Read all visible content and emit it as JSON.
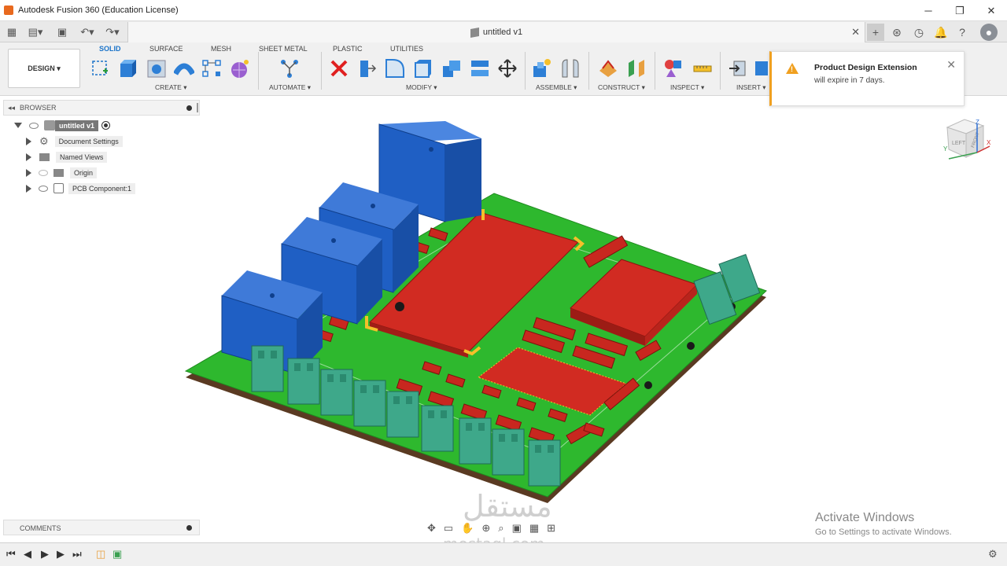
{
  "window": {
    "title": "Autodesk Fusion 360 (Education License)",
    "minimize": "─",
    "restore": "❐",
    "close": "✕"
  },
  "document": {
    "tab_title": "untitled v1",
    "tab_close": "✕"
  },
  "ribbon": {
    "workspace": "DESIGN ▾",
    "tabs": [
      "SOLID",
      "SURFACE",
      "MESH",
      "SHEET METAL",
      "PLASTIC",
      "UTILITIES"
    ],
    "active_tab": "SOLID",
    "groups": [
      "CREATE ▾",
      "AUTOMATE ▾",
      "MODIFY ▾",
      "ASSEMBLE ▾",
      "CONSTRUCT ▾",
      "INSPECT ▾",
      "INSERT ▾"
    ]
  },
  "notification": {
    "title": "Product Design Extension",
    "message": "will expire in 7 days."
  },
  "browser": {
    "header": "BROWSER",
    "root": "untitled v1",
    "items": [
      "Document Settings",
      "Named Views",
      "Origin",
      "PCB Component:1"
    ]
  },
  "comments": {
    "label": "COMMENTS"
  },
  "viewcube": {
    "left": "LEFT",
    "front": "FRONT",
    "axis_x": "X",
    "axis_y": "Y",
    "axis_z": "Z"
  },
  "watermark": {
    "arabic": "مستقل",
    "latin": "mostaql.com"
  },
  "activation": {
    "line1": "Activate Windows",
    "line2": "Go to Settings to activate Windows."
  },
  "colors": {
    "accent": "#1a73c9",
    "pcb": "#2eb82e",
    "relay": "#1f5fc4",
    "component": "#c8271f",
    "terminal": "#3ea88a",
    "warning": "#f0a020"
  },
  "icons": {
    "toolbar": [
      "sketch-icon",
      "extrude-icon",
      "hole-icon",
      "pipe-icon",
      "rect-pattern-icon",
      "form-icon",
      "automate-icon",
      "delete-icon",
      "press-pull-icon",
      "fillet-icon",
      "shell-icon",
      "combine-icon",
      "align-icon",
      "move-icon",
      "new-component-icon",
      "joint-icon",
      "offset-plane-icon",
      "midplane-icon",
      "inspect-icon",
      "measure-icon",
      "insert-icon",
      "canvas-icon"
    ]
  }
}
